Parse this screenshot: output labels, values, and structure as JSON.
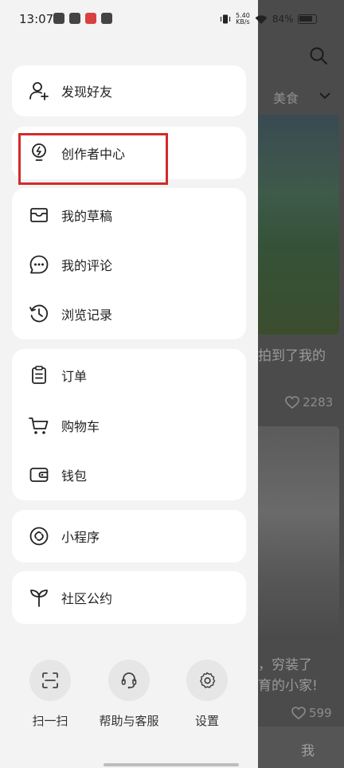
{
  "status_bar": {
    "time": "13:07",
    "net_speed_value": "5.40",
    "net_speed_unit": "KB/s",
    "battery": "84%"
  },
  "drawer": {
    "cards": [
      {
        "items": [
          {
            "label": "发现好友",
            "icon": "add-user-icon"
          }
        ]
      },
      {
        "items": [
          {
            "label": "创作者中心",
            "icon": "lightbulb-icon"
          }
        ]
      },
      {
        "items": [
          {
            "label": "我的草稿",
            "icon": "inbox-icon"
          },
          {
            "label": "我的评论",
            "icon": "comment-icon"
          },
          {
            "label": "浏览记录",
            "icon": "history-icon"
          }
        ]
      },
      {
        "items": [
          {
            "label": "订单",
            "icon": "clipboard-icon"
          },
          {
            "label": "购物车",
            "icon": "cart-icon"
          },
          {
            "label": "钱包",
            "icon": "wallet-icon"
          }
        ]
      },
      {
        "items": [
          {
            "label": "小程序",
            "icon": "link-icon"
          }
        ]
      },
      {
        "items": [
          {
            "label": "社区公约",
            "icon": "sprout-icon"
          }
        ]
      }
    ],
    "tools": [
      {
        "label": "扫一扫",
        "icon": "scan-icon"
      },
      {
        "label": "帮助与客服",
        "icon": "headset-icon"
      },
      {
        "label": "设置",
        "icon": "gear-icon"
      }
    ]
  },
  "background": {
    "tab_label": "美食",
    "card1_caption": "拍到了我的",
    "card1_likes": "2283",
    "card2_caption_line1": "，穷装了",
    "card2_caption_line2": "育的小家!",
    "card2_likes": "599",
    "bottom_nav_me": "我"
  },
  "colors": {
    "highlight": "#d42a2a",
    "drawer_bg": "#f3f3f3",
    "card_bg": "#ffffff"
  }
}
